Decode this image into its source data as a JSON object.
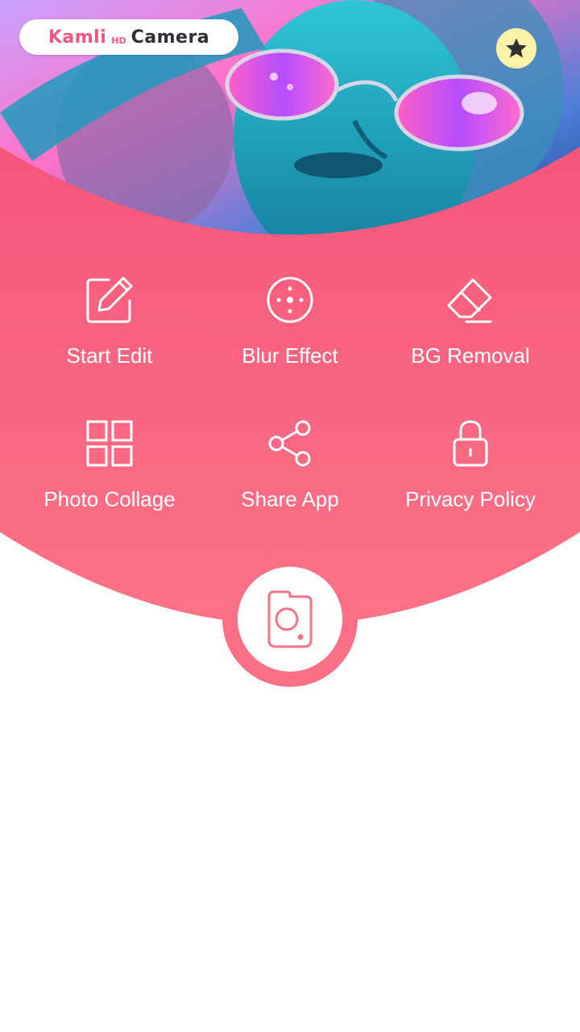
{
  "app": {
    "logo_part1": "Kamli",
    "logo_part2": "HD",
    "logo_part3": "Camera"
  },
  "colors": {
    "accent_top": "#f5577c",
    "accent_bottom": "#fb7386",
    "star_bg": "#fdf3a6",
    "icon_dark": "#2f2f36"
  },
  "menu": {
    "items": [
      {
        "label": "Start Edit",
        "icon": "pencil-edit-icon"
      },
      {
        "label": "Blur Effect",
        "icon": "blur-dial-icon"
      },
      {
        "label": "BG Removal",
        "icon": "eraser-icon"
      },
      {
        "label": "Photo Collage",
        "icon": "grid-collage-icon"
      },
      {
        "label": "Share App",
        "icon": "share-icon"
      },
      {
        "label": "Privacy Policy",
        "icon": "lock-icon"
      }
    ]
  },
  "actions": {
    "rate_icon": "star-icon",
    "camera_icon": "camera-icon"
  }
}
